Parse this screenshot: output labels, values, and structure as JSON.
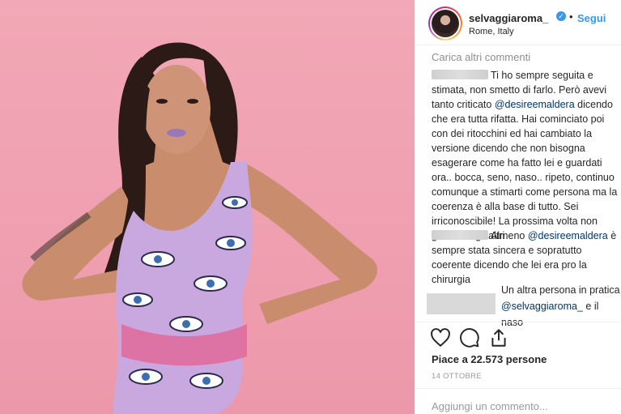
{
  "post": {
    "username": "selvaggiaroma_",
    "follow_label": "Segui",
    "separator": "•",
    "location": "Rome, Italy"
  },
  "comments": {
    "load_more_label": "Carica altri commenti",
    "c1": {
      "text_1": "Ti ho sempre seguita e stimata, non smetto di farlo. Però avevi tanto criticato ",
      "mention": "@desireemaldera",
      "text_2": " dicendo che era tutta rifatta. Hai cominciato poi con dei ritocchini ed hai cambiato la versione dicendo che non bisogna esagerare come ha fatto lei e guardati ora.. bocca, seno, naso.. ripeto, continuo comunque a stimarti come persona ma la coerenza è alla base di tutto. Sei irriconoscibile! La prossima volta non giudicare gli altri"
    },
    "c2": {
      "text_1": "Almeno ",
      "mention": "@desireemaldera",
      "text_2": " è sempre stata sincera e sopratutto coerente dicendo che lei era pro la chirurgia"
    },
    "c3": {
      "text_1": "Un altra persona in pratica ",
      "mention": "@selvaggiaroma_",
      "text_2": " e il naso"
    }
  },
  "actions": {
    "like_icon": "heart-icon",
    "comment_icon": "comment-bubble-icon",
    "share_icon": "share-icon"
  },
  "likes_text": "Piace a 22.573 persone",
  "date_text": "14 OTTOBRE",
  "add_comment_placeholder": "Aggiungi un commento...",
  "colors": {
    "background_pink": "#f2a8b6",
    "swimsuit_lilac": "#c9a8e0",
    "link_blue": "#3897f0",
    "mention_blue": "#003569"
  }
}
